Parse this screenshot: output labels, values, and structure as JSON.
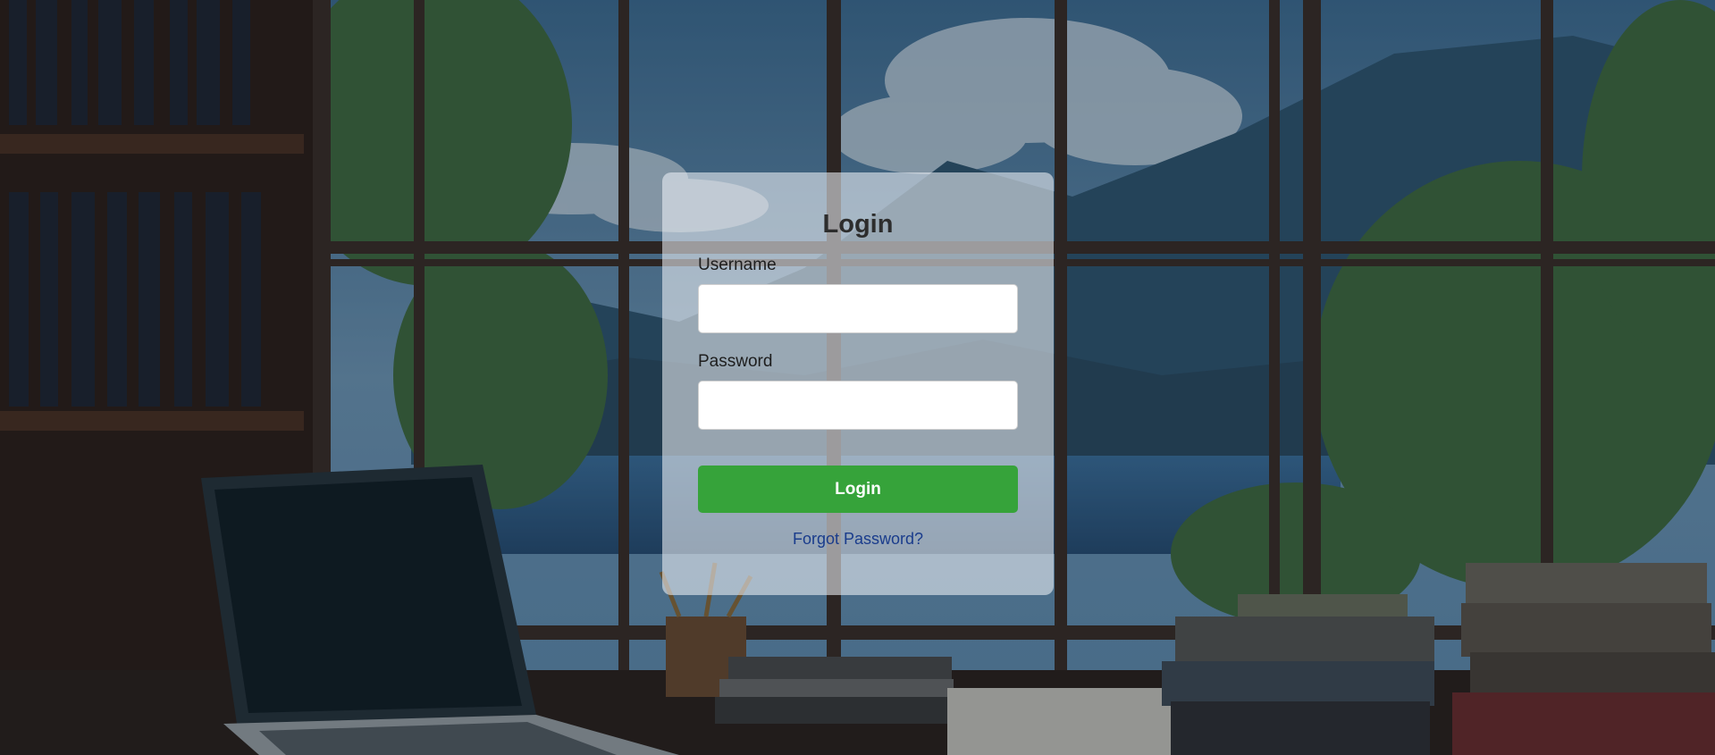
{
  "login": {
    "title": "Login",
    "username_label": "Username",
    "username_value": "",
    "password_label": "Password",
    "password_value": "",
    "submit_label": "Login",
    "forgot_link": "Forgot Password?"
  },
  "colors": {
    "button": "#36a33a",
    "link": "#1a3c8c",
    "card": "rgba(238,242,246,0.58)"
  }
}
